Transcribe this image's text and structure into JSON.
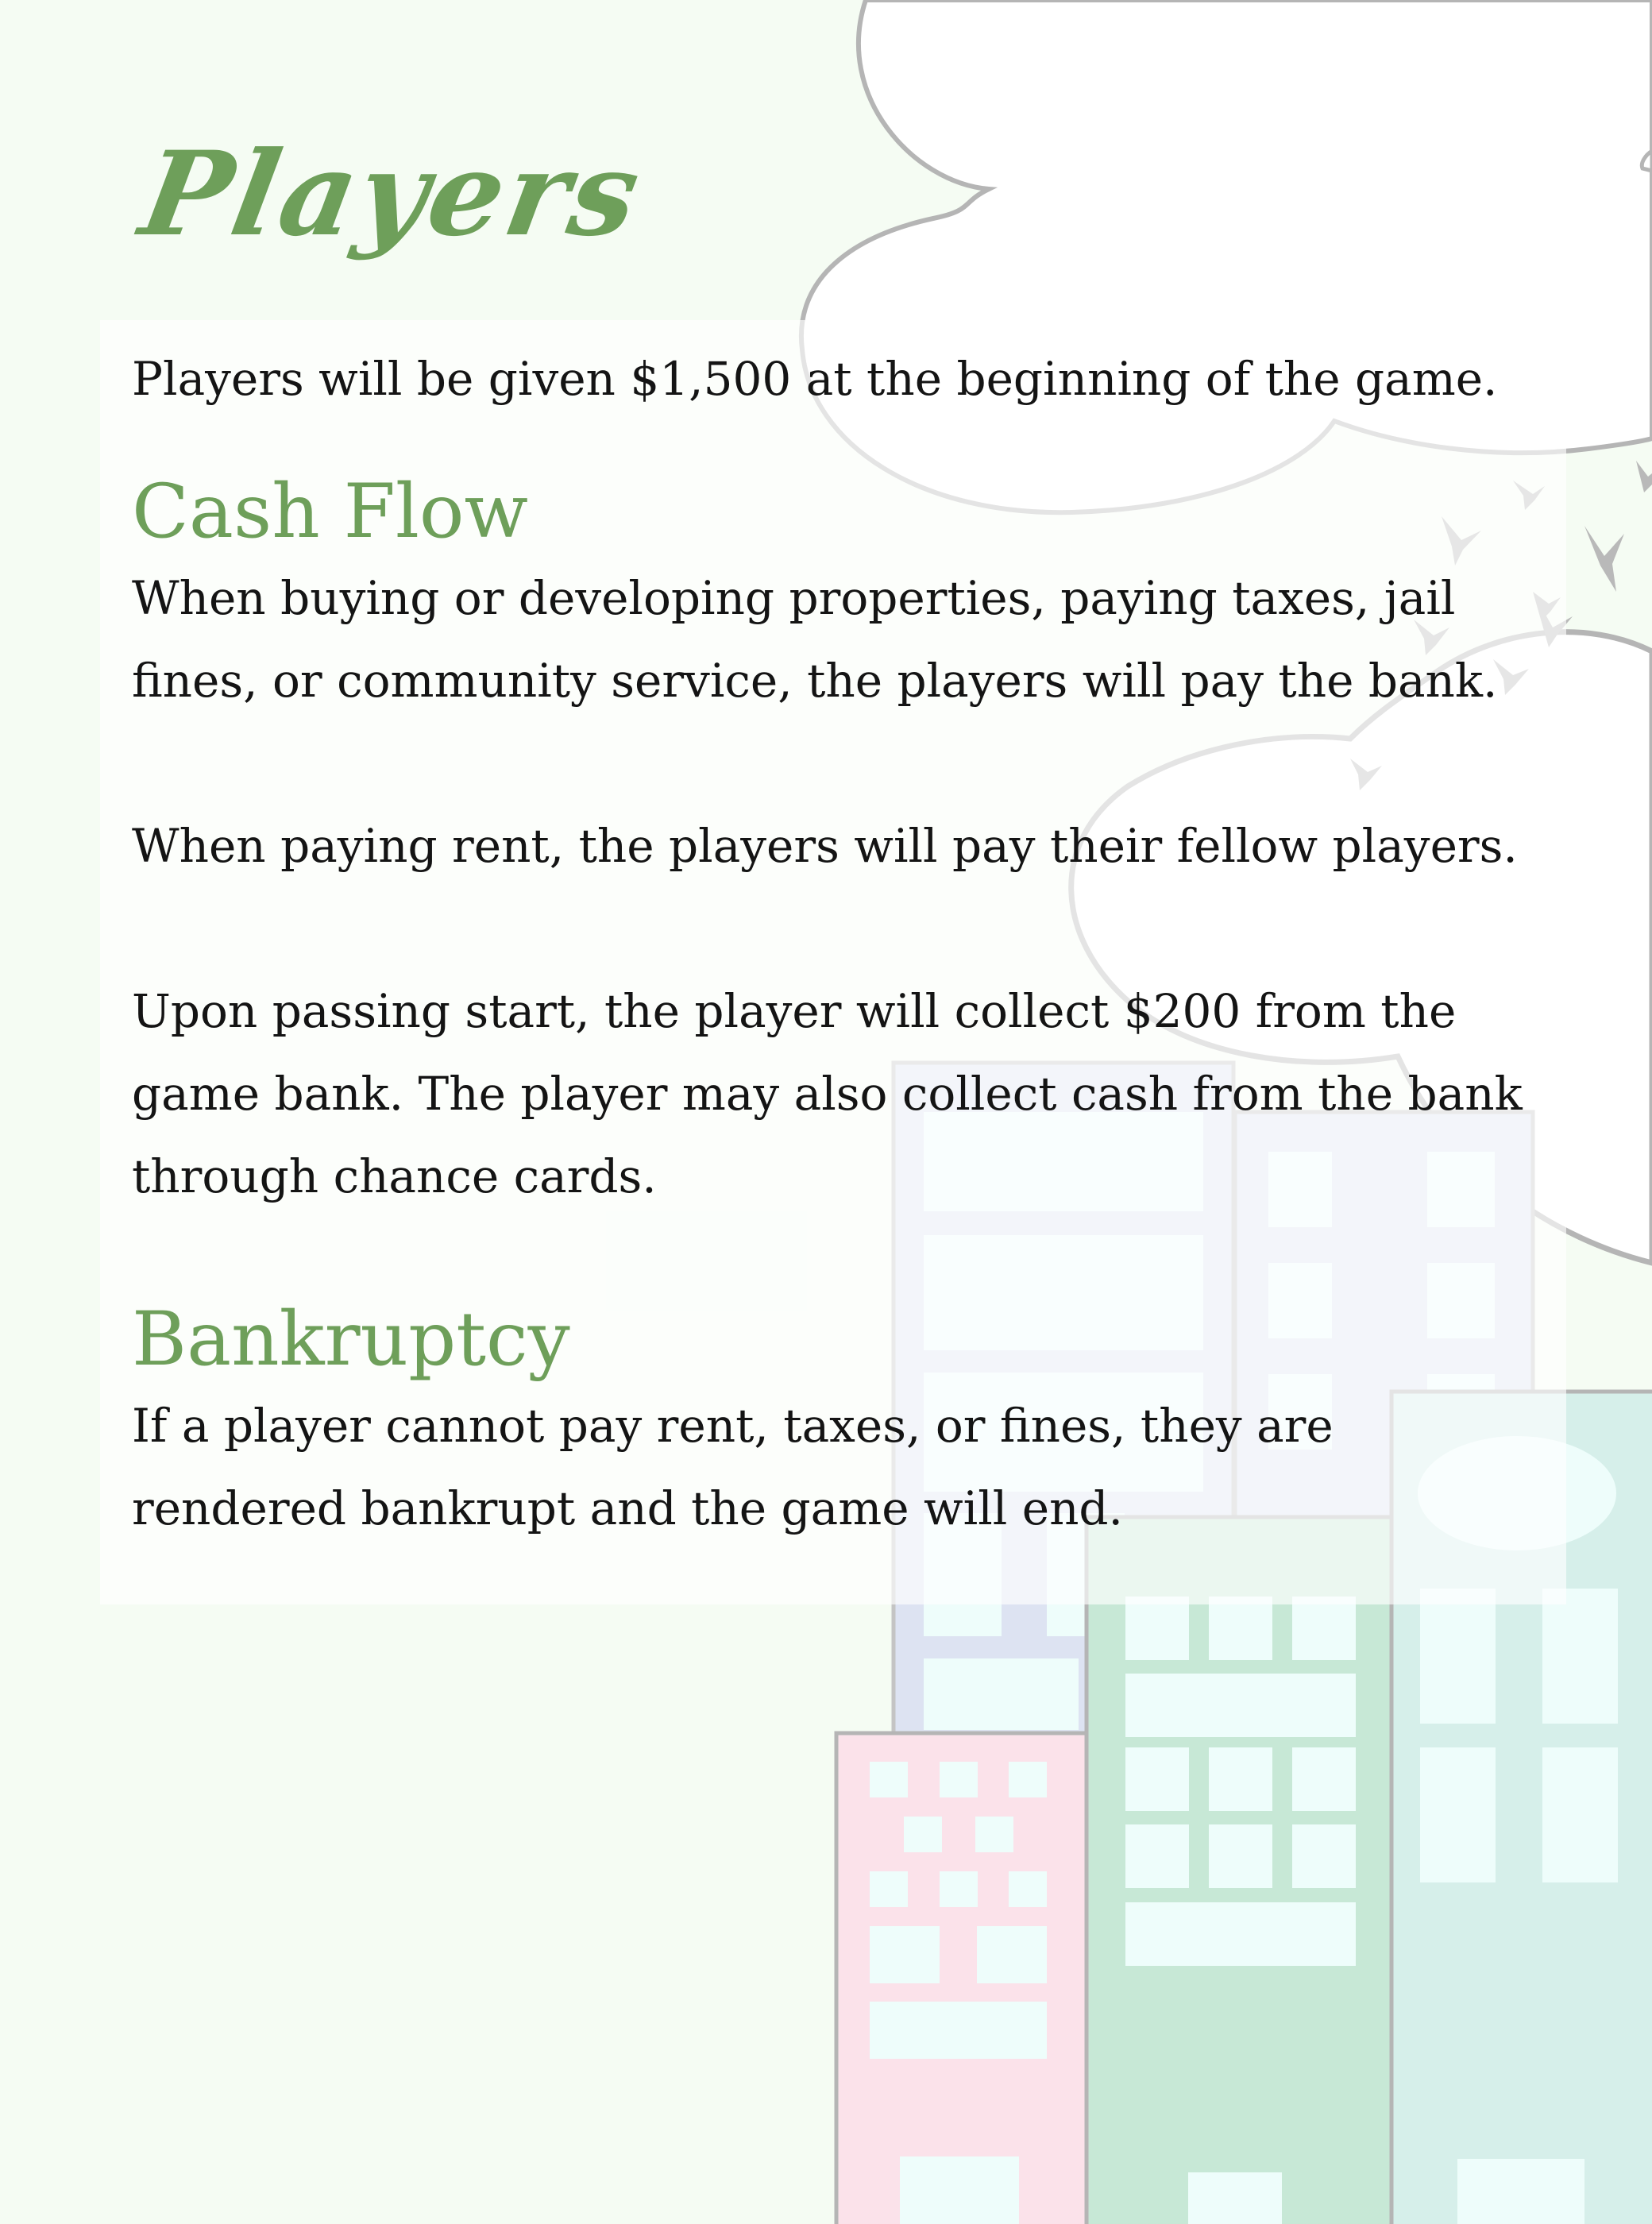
{
  "page": {
    "title": "Players",
    "intro": "Players will be given $1,500 at the beginning of  the game."
  },
  "sections": [
    {
      "heading": "Cash Flow",
      "paragraphs": [
        "When buying or developing properties, paying taxes, jail fines, or community service, the players will pay the bank.",
        "When paying rent, the players will pay their fellow players.",
        "Upon passing start, the player will collect $200 from the game bank. The player may also collect cash from the bank through chance cards."
      ]
    },
    {
      "heading": "Bankruptcy",
      "paragraphs": [
        "If  a player cannot pay rent, taxes, or fines, they are rendered bankrupt and the game will end."
      ]
    }
  ],
  "colors": {
    "background": "#f5fcf3",
    "accent_green": "#6e9f5a",
    "body_text": "#141414",
    "building_pink": "#fbe2ea",
    "building_green": "#c7e8d6",
    "building_teal": "#d6efea",
    "building_lavender": "#dde3f2",
    "window": "#eefdfb"
  },
  "decorations": [
    "cloud-illustration",
    "birds-illustration",
    "buildings-illustration"
  ]
}
